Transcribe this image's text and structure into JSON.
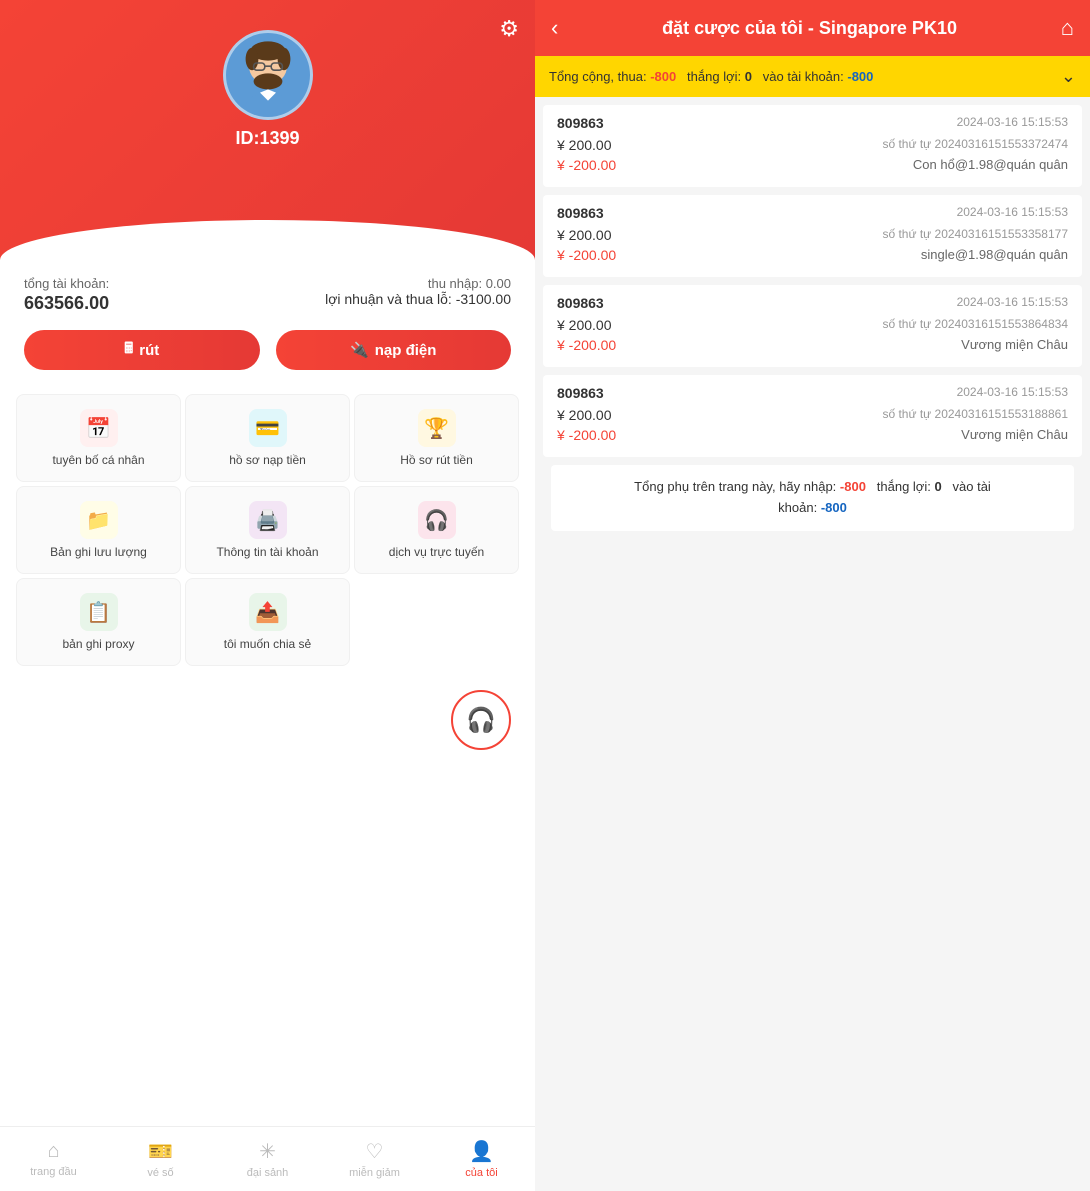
{
  "left": {
    "user": {
      "id": "ID:1399"
    },
    "account": {
      "total_label": "tổng tài khoản:",
      "total_value": "663566.00",
      "income_label": "thu nhập:",
      "income_value": "0.00",
      "profit_label": "lợi nhuận và thua lỗ:",
      "profit_value": "-3100.00"
    },
    "buttons": {
      "rut": "rút",
      "nap": "nạp điện"
    },
    "menu": [
      {
        "label": "tuyên bố cá nhân",
        "icon": "📅",
        "color": "icon-red"
      },
      {
        "label": "hồ sơ nạp tiền",
        "icon": "💳",
        "color": "icon-teal"
      },
      {
        "label": "Hồ sơ rút tiền",
        "icon": "🏆",
        "color": "icon-gold"
      },
      {
        "label": "Bản ghi lưu lượng",
        "icon": "📁",
        "color": "icon-yellow"
      },
      {
        "label": "Thông tin tài khoản",
        "icon": "🖨️",
        "color": "icon-purple"
      },
      {
        "label": "dịch vụ trực tuyến",
        "icon": "🎧",
        "color": "icon-pink"
      },
      {
        "label": "bản ghi proxy",
        "icon": "📋",
        "color": "icon-green"
      },
      {
        "label": "tôi muốn chia sẻ",
        "icon": "📤",
        "color": "icon-green2"
      }
    ],
    "nav": [
      {
        "label": "trang đầu",
        "icon": "⌂",
        "active": false
      },
      {
        "label": "vé số",
        "icon": "🎫",
        "active": false
      },
      {
        "label": "đại sảnh",
        "icon": "✳",
        "active": false
      },
      {
        "label": "miễn giảm",
        "icon": "♡",
        "active": false
      },
      {
        "label": "của tôi",
        "icon": "👤",
        "active": true
      }
    ]
  },
  "right": {
    "header": {
      "title": "đặt cược của tôi - Singapore PK10",
      "back": "‹",
      "home": "⌂"
    },
    "summary": {
      "prefix": "Tổng cộng, thua:",
      "loss": "-800",
      "win_label": "thắng lợi:",
      "win": "0",
      "account_label": "vào tài khoản:",
      "account": "-800"
    },
    "bets": [
      {
        "id": "809863",
        "time": "2024-03-16 15:15:53",
        "amount": "¥ 200.00",
        "serial": "số thứ tự 20240316151553372474",
        "loss": "¥ -200.00",
        "desc": "Con hổ@1.98@quán quân"
      },
      {
        "id": "809863",
        "time": "2024-03-16 15:15:53",
        "amount": "¥ 200.00",
        "serial": "số thứ tự 20240316151553358177",
        "loss": "¥ -200.00",
        "desc": "single@1.98@quán quân"
      },
      {
        "id": "809863",
        "time": "2024-03-16 15:15:53",
        "amount": "¥ 200.00",
        "serial": "số thứ tự 20240316151553864834",
        "loss": "¥ -200.00",
        "desc": "Vương miện Châu"
      },
      {
        "id": "809863",
        "time": "2024-03-16 15:15:53",
        "amount": "¥ 200.00",
        "serial": "số thứ tự 20240316151553188861",
        "loss": "¥ -200.00",
        "desc": "Vương miện Châu"
      }
    ],
    "page_summary": {
      "text1": "Tổng phụ trên trang này, hãy nhập:",
      "loss": "-800",
      "win_label": "thắng lợi:",
      "win": "0",
      "account_label": "vào tài",
      "account_label2": "khoản:",
      "account": "-800"
    }
  }
}
